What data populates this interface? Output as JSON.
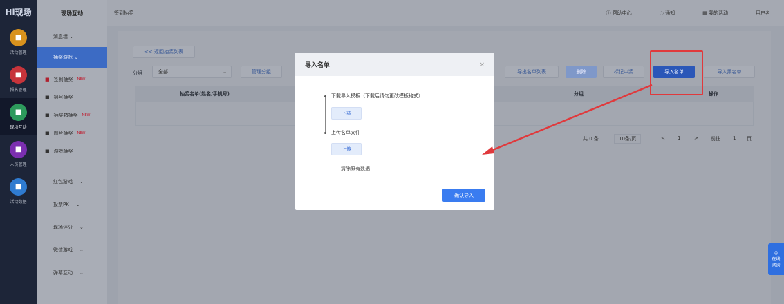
{
  "app": {
    "logo": "Hi现场"
  },
  "rail": [
    {
      "label": "活动管理",
      "icon": "calendar-icon",
      "color": "#d8921d"
    },
    {
      "label": "报名管理",
      "icon": "form-icon",
      "color": "#c7343b"
    },
    {
      "label": "现场互动",
      "icon": "interact-icon",
      "color": "#2d9a5c"
    },
    {
      "label": "人员管理",
      "icon": "person-icon",
      "color": "#7b2fb0"
    },
    {
      "label": "活动数据",
      "icon": "chart-icon",
      "color": "#2f7bd0"
    }
  ],
  "side": {
    "title": "现场互动",
    "groups": [
      {
        "label": "消息墙 ⌄"
      },
      {
        "label": "抽奖游戏 ⌄"
      }
    ],
    "subs": [
      {
        "label": "签到抽奖",
        "new": "NEW",
        "icon": "gift-icon"
      },
      {
        "label": "摇号抽奖",
        "new": "",
        "icon": "user-icon"
      },
      {
        "label": "抽奖箱抽奖",
        "new": "NEW",
        "icon": "box-icon"
      },
      {
        "label": "图片抽奖",
        "new": "NEW",
        "icon": "image-icon"
      },
      {
        "label": "游戏抽奖",
        "new": "",
        "icon": "wheel-icon"
      }
    ],
    "more": [
      "红包游戏",
      "投票PK",
      "现场评分",
      "微信游戏",
      "弹幕互动"
    ]
  },
  "top": {
    "crumb": "签到抽奖",
    "help": "帮助中心",
    "notice": "通知",
    "activity": "我的活动",
    "user": "用户名"
  },
  "toolbar": {
    "back": "<< 返回抽奖列表",
    "group_label": "分组",
    "group_value": "全部",
    "manage_group": "管理分组",
    "export": "导出名单列表",
    "delete": "删除",
    "mark": "标记中奖",
    "import": "导入名单",
    "import_black": "导入黑名单"
  },
  "table": {
    "col1": "抽奖名单(姓名/手机号)",
    "col2": "分组",
    "col3": "操作"
  },
  "pager": {
    "total": "共 0 条",
    "size": "10条/页",
    "prev": "<",
    "page": "1",
    "next": ">",
    "goto": "前往",
    "goto_page": "1",
    "unit": "页"
  },
  "modal": {
    "title": "导入名单",
    "close": "×",
    "step1": "下载导入模板（下载后请勿更改模板格式）",
    "download": "下载",
    "step2": "上传名单文件",
    "upload": "上传",
    "clear": "清除原有数据",
    "confirm": "确认导入"
  },
  "float": {
    "label": "在线咨询"
  },
  "annotation_color": "#e0393c"
}
